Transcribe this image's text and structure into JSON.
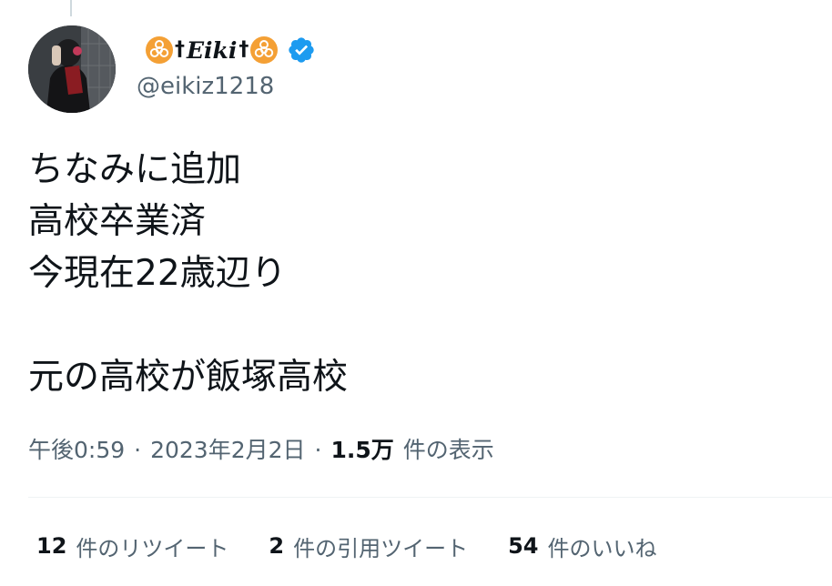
{
  "author": {
    "display_name": "Eiki",
    "name_prefix_glyphs": "☣†",
    "name_suffix_glyphs": "†☣",
    "handle": "@eikiz1218",
    "verified": true,
    "verified_color": "#1d9bf0",
    "emoji_color": "#f4a035"
  },
  "tweet": {
    "lines": [
      "ちなみに追加",
      "高校卒業済",
      "今現在22歳辺り",
      "",
      "元の高校が飯塚高校"
    ]
  },
  "meta": {
    "time": "午後0:59",
    "separator": "·",
    "date": "2023年2月2日",
    "views_count": "1.5万",
    "views_label": "件の表示"
  },
  "stats": {
    "retweets_count": "12",
    "retweets_label": "件のリツイート",
    "quotes_count": "2",
    "quotes_label": "件の引用ツイート",
    "likes_count": "54",
    "likes_label": "件のいいね"
  },
  "colors": {
    "text_primary": "#0f1419",
    "text_secondary": "#536471",
    "divider": "#eff3f4"
  }
}
